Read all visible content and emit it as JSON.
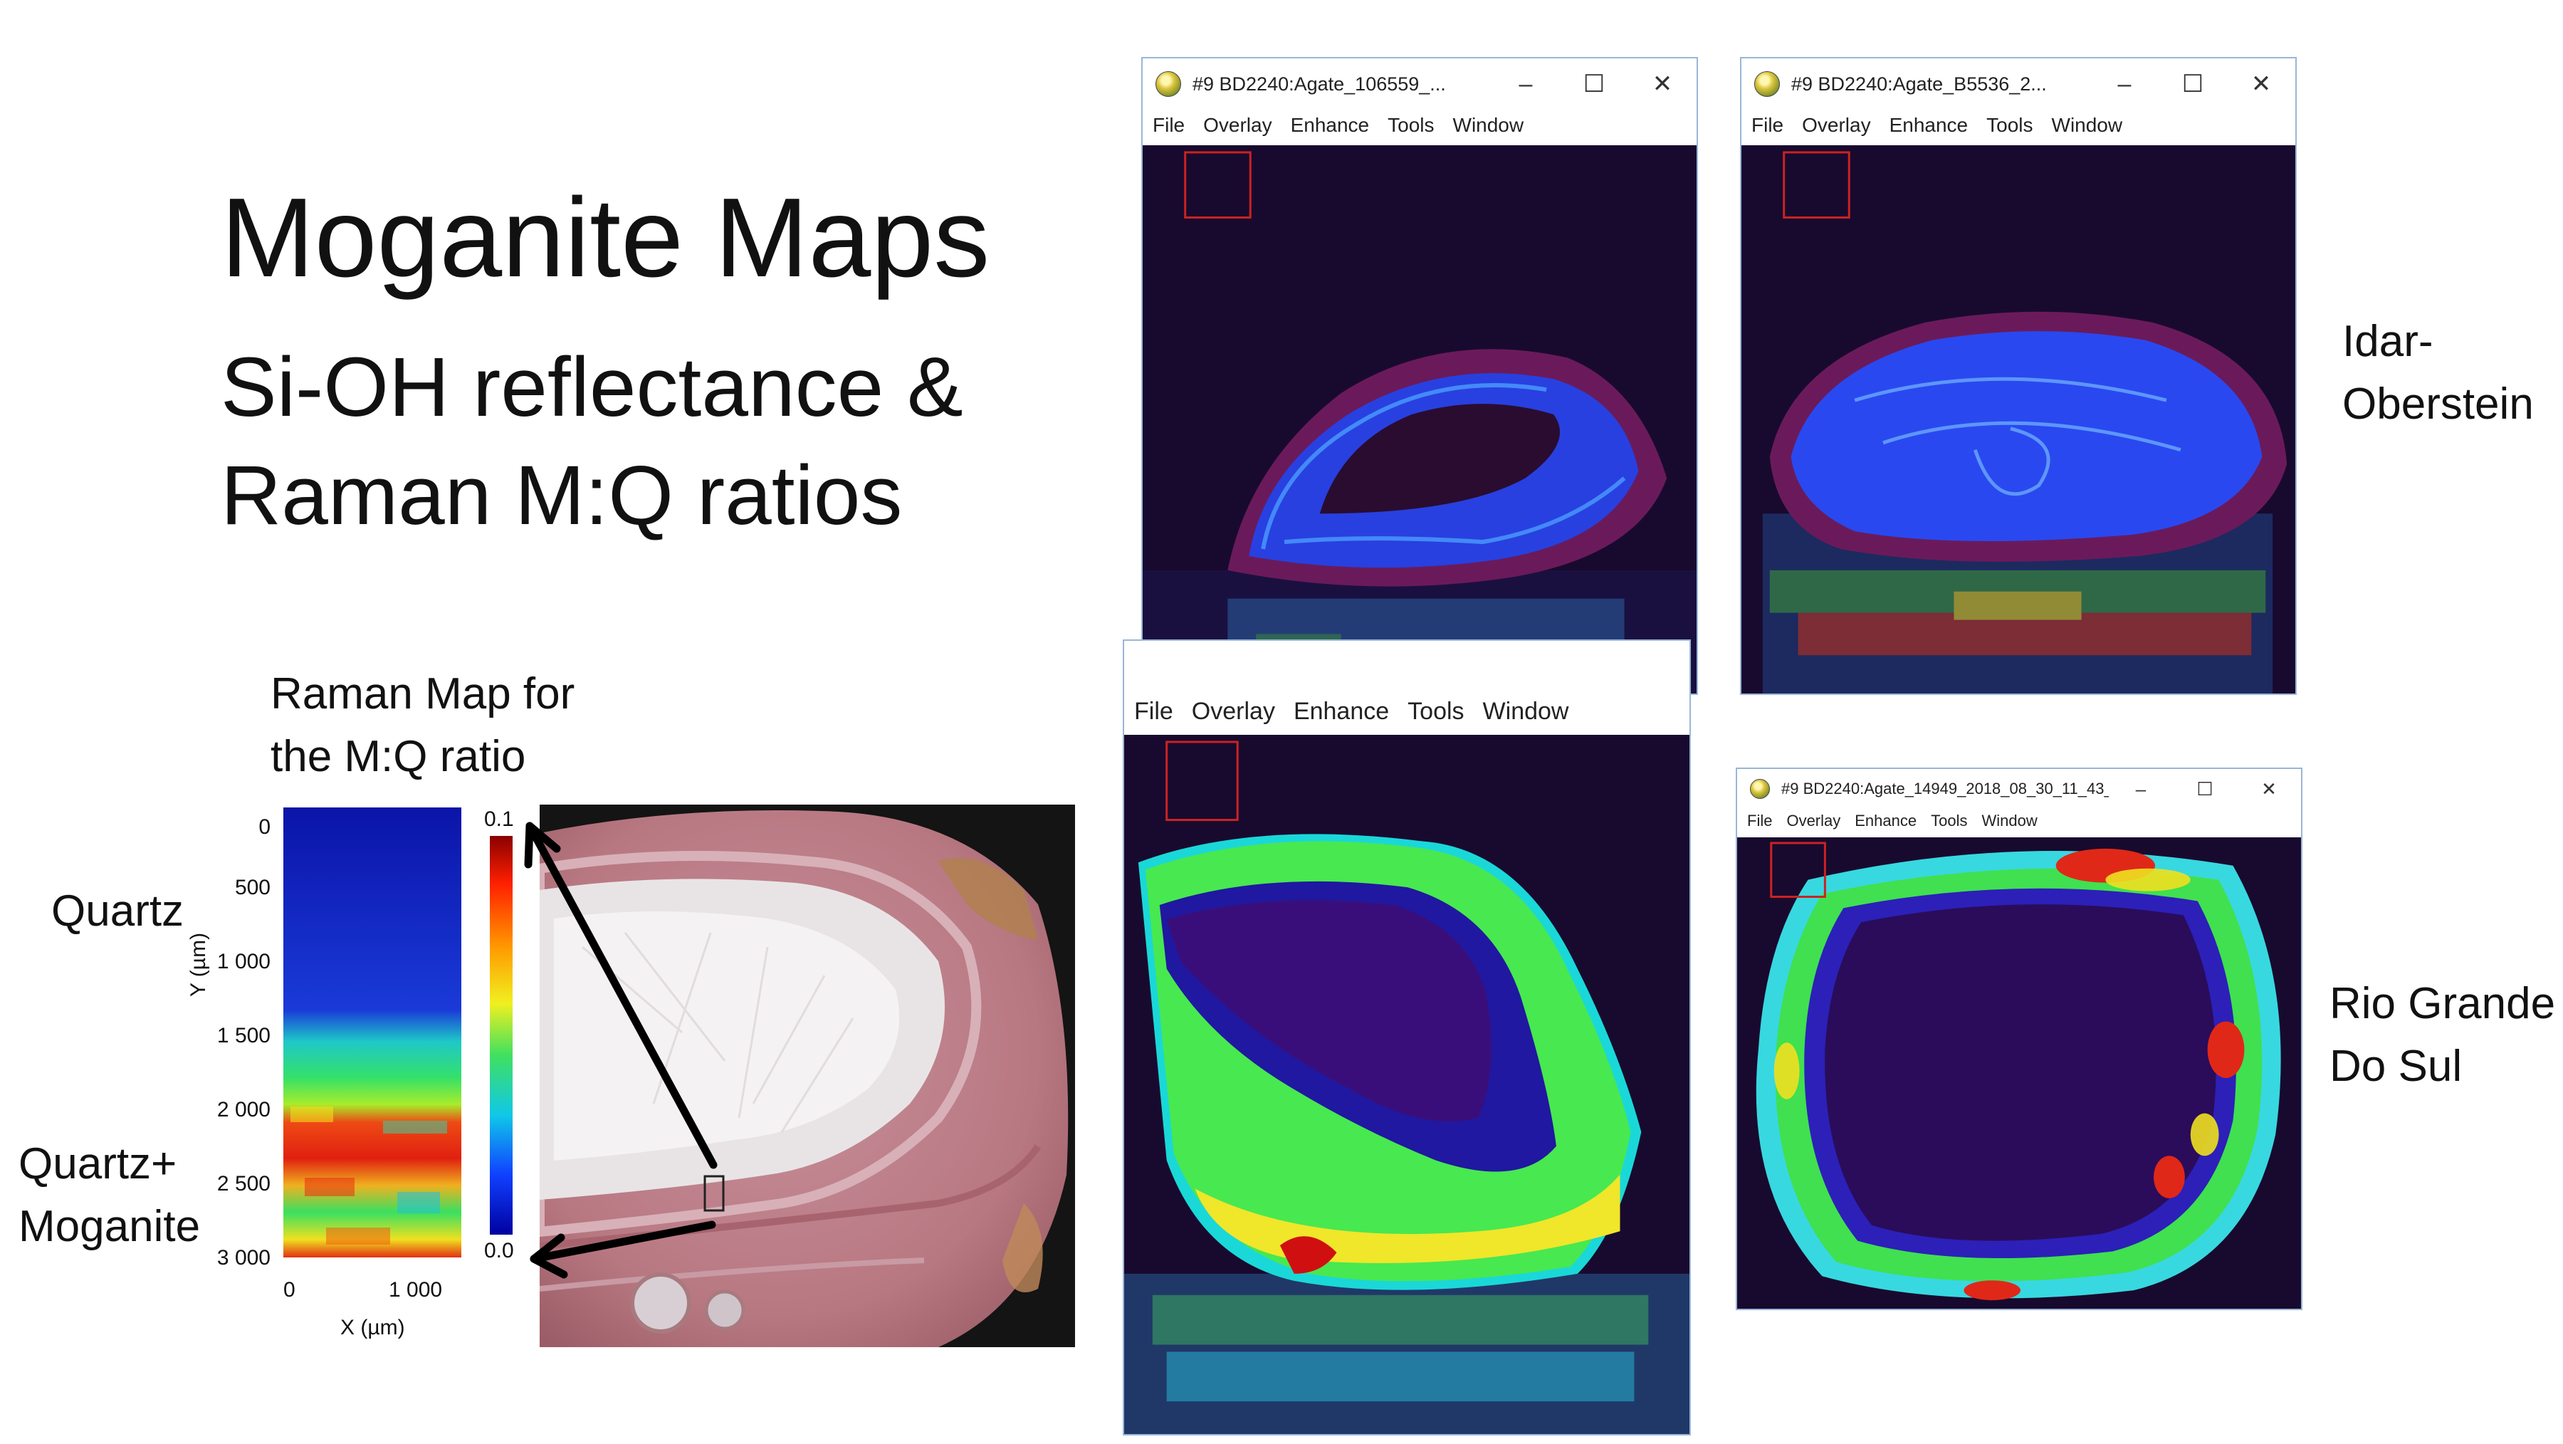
{
  "slide": {
    "title": "Moganite Maps",
    "subtitle_line1": "Si-OH reflectance &",
    "subtitle_line2": "Raman M:Q ratios",
    "raman_caption_line1": "Raman Map for",
    "raman_caption_line2": "the M:Q ratio",
    "label_quartz": "Quartz",
    "label_qm_line1": "Quartz+",
    "label_qm_line2": "Moganite",
    "label_idar_line1": "Idar-",
    "label_idar_line2": "Oberstein",
    "label_rio_line1": "Rio Grande",
    "label_rio_line2": "Do Sul"
  },
  "raman_map": {
    "ylabel": "Y (µm)",
    "xlabel": "X (µm)",
    "y_ticks": [
      "0",
      "500",
      "1 000",
      "1 500",
      "2 000",
      "2 500",
      "3 000"
    ],
    "x_ticks": [
      "0",
      "1 000"
    ],
    "colorbar_max": "0.1",
    "colorbar_min": "0.0",
    "colors": {
      "low": "#0a14c8",
      "mid": "#22e07a",
      "high": "#e02010"
    }
  },
  "windows": [
    {
      "id": "win1",
      "title": "#9 BD2240:Agate_106559_...",
      "menu": [
        "File",
        "Overlay",
        "Enhance",
        "Tools",
        "Window"
      ],
      "controls": {
        "minimize": "–",
        "maximize": "☐",
        "close": "✕"
      }
    },
    {
      "id": "win2",
      "title": "#9 BD2240:Agate_B5536_2...",
      "menu": [
        "File",
        "Overlay",
        "Enhance",
        "Tools",
        "Window"
      ],
      "controls": {
        "minimize": "–",
        "maximize": "☐",
        "close": "✕"
      }
    },
    {
      "id": "win3",
      "title": "",
      "menu": [
        "File",
        "Overlay",
        "Enhance",
        "Tools",
        "Window"
      ]
    },
    {
      "id": "win4",
      "title": "#9 BD2240:Agate_14949_2018_08_30_11_43_...",
      "menu": [
        "File",
        "Overlay",
        "Enhance",
        "Tools",
        "Window"
      ],
      "controls": {
        "minimize": "–",
        "maximize": "☐",
        "close": "✕"
      }
    }
  ],
  "icons": [
    "app-globe-icon",
    "minimize-icon",
    "maximize-icon",
    "close-icon",
    "arrow-icon"
  ]
}
